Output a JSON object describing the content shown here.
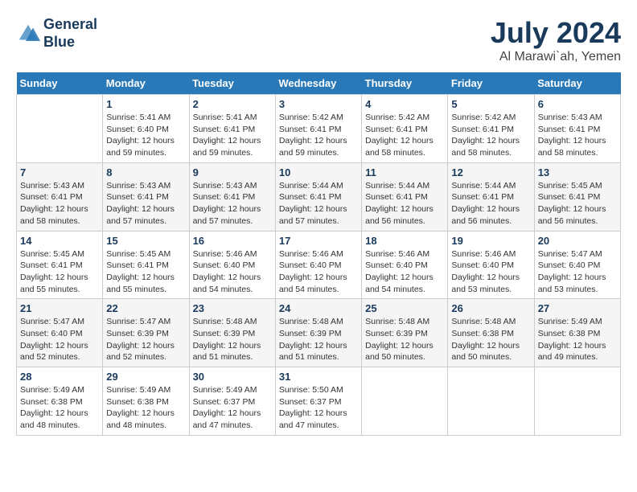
{
  "logo": {
    "line1": "General",
    "line2": "Blue"
  },
  "title": "July 2024",
  "subtitle": "Al Marawi`ah, Yemen",
  "days_of_week": [
    "Sunday",
    "Monday",
    "Tuesday",
    "Wednesday",
    "Thursday",
    "Friday",
    "Saturday"
  ],
  "weeks": [
    [
      {
        "day": "",
        "sunrise": "",
        "sunset": "",
        "daylight": ""
      },
      {
        "day": "1",
        "sunrise": "Sunrise: 5:41 AM",
        "sunset": "Sunset: 6:40 PM",
        "daylight": "Daylight: 12 hours and 59 minutes."
      },
      {
        "day": "2",
        "sunrise": "Sunrise: 5:41 AM",
        "sunset": "Sunset: 6:41 PM",
        "daylight": "Daylight: 12 hours and 59 minutes."
      },
      {
        "day": "3",
        "sunrise": "Sunrise: 5:42 AM",
        "sunset": "Sunset: 6:41 PM",
        "daylight": "Daylight: 12 hours and 59 minutes."
      },
      {
        "day": "4",
        "sunrise": "Sunrise: 5:42 AM",
        "sunset": "Sunset: 6:41 PM",
        "daylight": "Daylight: 12 hours and 58 minutes."
      },
      {
        "day": "5",
        "sunrise": "Sunrise: 5:42 AM",
        "sunset": "Sunset: 6:41 PM",
        "daylight": "Daylight: 12 hours and 58 minutes."
      },
      {
        "day": "6",
        "sunrise": "Sunrise: 5:43 AM",
        "sunset": "Sunset: 6:41 PM",
        "daylight": "Daylight: 12 hours and 58 minutes."
      }
    ],
    [
      {
        "day": "7",
        "sunrise": "Sunrise: 5:43 AM",
        "sunset": "Sunset: 6:41 PM",
        "daylight": "Daylight: 12 hours and 58 minutes."
      },
      {
        "day": "8",
        "sunrise": "Sunrise: 5:43 AM",
        "sunset": "Sunset: 6:41 PM",
        "daylight": "Daylight: 12 hours and 57 minutes."
      },
      {
        "day": "9",
        "sunrise": "Sunrise: 5:43 AM",
        "sunset": "Sunset: 6:41 PM",
        "daylight": "Daylight: 12 hours and 57 minutes."
      },
      {
        "day": "10",
        "sunrise": "Sunrise: 5:44 AM",
        "sunset": "Sunset: 6:41 PM",
        "daylight": "Daylight: 12 hours and 57 minutes."
      },
      {
        "day": "11",
        "sunrise": "Sunrise: 5:44 AM",
        "sunset": "Sunset: 6:41 PM",
        "daylight": "Daylight: 12 hours and 56 minutes."
      },
      {
        "day": "12",
        "sunrise": "Sunrise: 5:44 AM",
        "sunset": "Sunset: 6:41 PM",
        "daylight": "Daylight: 12 hours and 56 minutes."
      },
      {
        "day": "13",
        "sunrise": "Sunrise: 5:45 AM",
        "sunset": "Sunset: 6:41 PM",
        "daylight": "Daylight: 12 hours and 56 minutes."
      }
    ],
    [
      {
        "day": "14",
        "sunrise": "Sunrise: 5:45 AM",
        "sunset": "Sunset: 6:41 PM",
        "daylight": "Daylight: 12 hours and 55 minutes."
      },
      {
        "day": "15",
        "sunrise": "Sunrise: 5:45 AM",
        "sunset": "Sunset: 6:41 PM",
        "daylight": "Daylight: 12 hours and 55 minutes."
      },
      {
        "day": "16",
        "sunrise": "Sunrise: 5:46 AM",
        "sunset": "Sunset: 6:40 PM",
        "daylight": "Daylight: 12 hours and 54 minutes."
      },
      {
        "day": "17",
        "sunrise": "Sunrise: 5:46 AM",
        "sunset": "Sunset: 6:40 PM",
        "daylight": "Daylight: 12 hours and 54 minutes."
      },
      {
        "day": "18",
        "sunrise": "Sunrise: 5:46 AM",
        "sunset": "Sunset: 6:40 PM",
        "daylight": "Daylight: 12 hours and 54 minutes."
      },
      {
        "day": "19",
        "sunrise": "Sunrise: 5:46 AM",
        "sunset": "Sunset: 6:40 PM",
        "daylight": "Daylight: 12 hours and 53 minutes."
      },
      {
        "day": "20",
        "sunrise": "Sunrise: 5:47 AM",
        "sunset": "Sunset: 6:40 PM",
        "daylight": "Daylight: 12 hours and 53 minutes."
      }
    ],
    [
      {
        "day": "21",
        "sunrise": "Sunrise: 5:47 AM",
        "sunset": "Sunset: 6:40 PM",
        "daylight": "Daylight: 12 hours and 52 minutes."
      },
      {
        "day": "22",
        "sunrise": "Sunrise: 5:47 AM",
        "sunset": "Sunset: 6:39 PM",
        "daylight": "Daylight: 12 hours and 52 minutes."
      },
      {
        "day": "23",
        "sunrise": "Sunrise: 5:48 AM",
        "sunset": "Sunset: 6:39 PM",
        "daylight": "Daylight: 12 hours and 51 minutes."
      },
      {
        "day": "24",
        "sunrise": "Sunrise: 5:48 AM",
        "sunset": "Sunset: 6:39 PM",
        "daylight": "Daylight: 12 hours and 51 minutes."
      },
      {
        "day": "25",
        "sunrise": "Sunrise: 5:48 AM",
        "sunset": "Sunset: 6:39 PM",
        "daylight": "Daylight: 12 hours and 50 minutes."
      },
      {
        "day": "26",
        "sunrise": "Sunrise: 5:48 AM",
        "sunset": "Sunset: 6:38 PM",
        "daylight": "Daylight: 12 hours and 50 minutes."
      },
      {
        "day": "27",
        "sunrise": "Sunrise: 5:49 AM",
        "sunset": "Sunset: 6:38 PM",
        "daylight": "Daylight: 12 hours and 49 minutes."
      }
    ],
    [
      {
        "day": "28",
        "sunrise": "Sunrise: 5:49 AM",
        "sunset": "Sunset: 6:38 PM",
        "daylight": "Daylight: 12 hours and 48 minutes."
      },
      {
        "day": "29",
        "sunrise": "Sunrise: 5:49 AM",
        "sunset": "Sunset: 6:38 PM",
        "daylight": "Daylight: 12 hours and 48 minutes."
      },
      {
        "day": "30",
        "sunrise": "Sunrise: 5:49 AM",
        "sunset": "Sunset: 6:37 PM",
        "daylight": "Daylight: 12 hours and 47 minutes."
      },
      {
        "day": "31",
        "sunrise": "Sunrise: 5:50 AM",
        "sunset": "Sunset: 6:37 PM",
        "daylight": "Daylight: 12 hours and 47 minutes."
      },
      {
        "day": "",
        "sunrise": "",
        "sunset": "",
        "daylight": ""
      },
      {
        "day": "",
        "sunrise": "",
        "sunset": "",
        "daylight": ""
      },
      {
        "day": "",
        "sunrise": "",
        "sunset": "",
        "daylight": ""
      }
    ]
  ]
}
